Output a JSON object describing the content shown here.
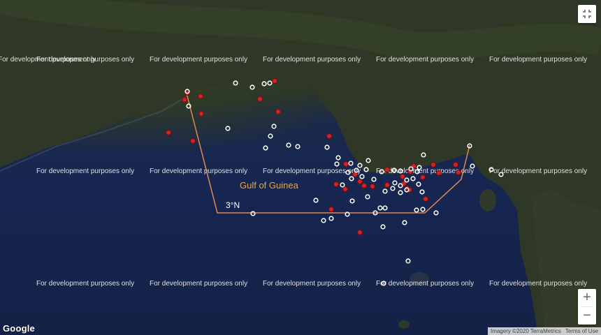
{
  "watermark_text": "For development purposes only",
  "labels": {
    "sea_name": "Gulf of Guinea",
    "parallel": "3°N"
  },
  "controls": {
    "zoom_in": "+",
    "zoom_out": "−"
  },
  "branding": {
    "logo": "Google",
    "imagery_credit": "Imagery ©2020 TerraMetrics",
    "terms": "Terms of Use"
  },
  "colors": {
    "boundary_line": "#e08a4e",
    "red_marker": "#d62222",
    "white_marker": "#ffffff",
    "sea_label": "#e8a73a"
  },
  "icons": [
    "fullscreen-exit-icon"
  ]
}
